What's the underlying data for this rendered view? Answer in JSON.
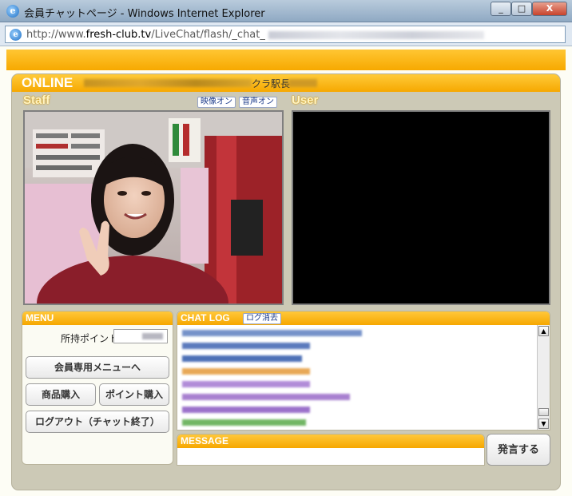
{
  "window": {
    "title": "会員チャットページ - Windows Internet Explorer",
    "minimize": "_",
    "maximize": "□",
    "close": "X",
    "url_prefix": "http://www.",
    "url_domain": "fresh-club.tv",
    "url_path": "/LiveChat/flash/_chat_"
  },
  "online": {
    "title": "ONLINE",
    "staff_name": "クラ駅長"
  },
  "staff": {
    "label": "Staff",
    "video_on_button": "映像オン",
    "audio_on_button": "音声オン"
  },
  "user": {
    "label": "User"
  },
  "menu": {
    "header": "MENU",
    "points_label": "所持ポイント",
    "member_menu_button": "会員専用メニューへ",
    "buy_products_button": "商品購入",
    "buy_points_button": "ポイント購入",
    "logout_button": "ログアウト（チャット終了）"
  },
  "chat": {
    "header": "CHAT LOG",
    "clear_button": "ログ消去",
    "line_colors": [
      "#5d7fc0",
      "#3f63b2",
      "#2f58aa",
      "#e49a3a",
      "#a478d2",
      "#9a6bc8",
      "#8a59c2",
      "#5aaa4a",
      "#8a59c2"
    ],
    "line_widths": [
      225,
      160,
      150,
      160,
      160,
      210,
      160,
      155,
      160
    ]
  },
  "message": {
    "header": "MESSAGE",
    "send_button": "発言する"
  },
  "colors": {
    "accent_orange": "#f6a800",
    "panel_bg": "#ccc9b6"
  }
}
